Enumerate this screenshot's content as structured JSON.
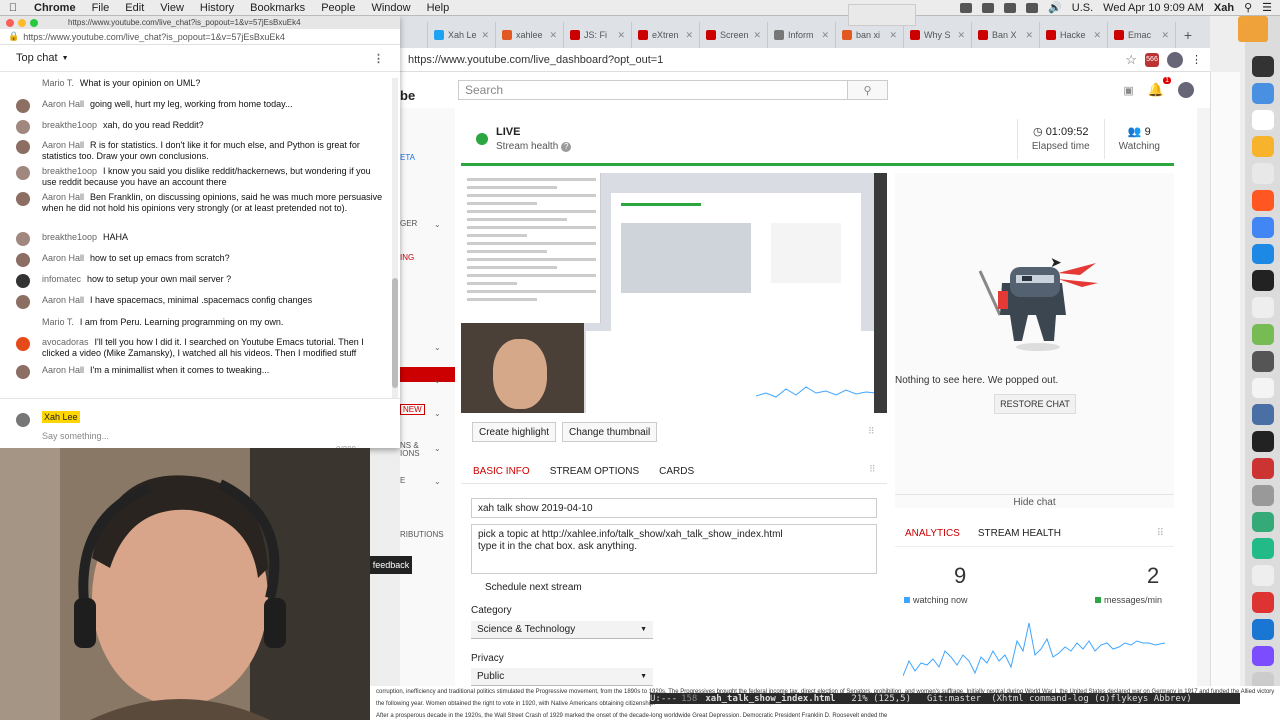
{
  "menubar": {
    "app": "Chrome",
    "items": [
      "File",
      "Edit",
      "View",
      "History",
      "Bookmarks",
      "People",
      "Window",
      "Help"
    ],
    "locale": "U.S.",
    "clock": "Wed Apr 10  9:09 AM",
    "user": "Xah"
  },
  "browser": {
    "tabs": [
      {
        "label": "Xah Le",
        "color": "#1da1f2"
      },
      {
        "label": "xahlee",
        "color": "#e25822"
      },
      {
        "label": "JS: Fi",
        "color": "#c00"
      },
      {
        "label": "eXtren",
        "color": "#c00"
      },
      {
        "label": "Screen",
        "color": "#c00"
      },
      {
        "label": "Inform",
        "color": "#777"
      },
      {
        "label": "ban xi",
        "color": "#e25822"
      },
      {
        "label": "Why S",
        "color": "#c00"
      },
      {
        "label": "Ban X",
        "color": "#c00"
      },
      {
        "label": "Hacke",
        "color": "#c00"
      },
      {
        "label": "Emac",
        "color": "#c00"
      }
    ],
    "url": "https://www.youtube.com/live_dashboard?opt_out=1",
    "ext_badge": "566"
  },
  "youtube": {
    "logo_fragment": "be",
    "search_placeholder": "Search",
    "bell_badge": "1",
    "sidebar": {
      "frag1": "ETA",
      "frag2": "GER",
      "frag3": "ING",
      "new_badge": "NEW",
      "frag4": "NS &",
      "frag5": "IONS",
      "frag6": "E",
      "frag7": "RIBUTIONS",
      "feedback": "feedback"
    },
    "status": {
      "live": "LIVE",
      "health": "Stream health",
      "elapsed_value": "01:09:52",
      "elapsed_label": "Elapsed time",
      "watching_value": "9",
      "watching_label": "Watching"
    },
    "buttons": {
      "highlight": "Create highlight",
      "thumbnail": "Change thumbnail"
    },
    "popped": {
      "message": "Nothing to see here. We popped out.",
      "restore": "RESTORE CHAT",
      "hide": "Hide chat"
    },
    "info": {
      "tabs": [
        "BASIC INFO",
        "STREAM OPTIONS",
        "CARDS"
      ],
      "title": "xah talk show 2019-04-10",
      "description_line1": "pick a topic at http://xahlee.info/talk_show/xah_talk_show_index.html",
      "description_line2": "type it in the chat box. ask anything.",
      "schedule": "Schedule next stream",
      "category_label": "Category",
      "category_value": "Science & Technology",
      "privacy_label": "Privacy",
      "privacy_value": "Public"
    },
    "analytics": {
      "tabs": [
        "ANALYTICS",
        "STREAM HEALTH"
      ],
      "watching_now": "9",
      "watching_now_label": "watching now",
      "messages": "2",
      "messages_label": "messages/min",
      "watching_color": "#3ea6ff",
      "messages_color": "#2ba640"
    }
  },
  "chat_window": {
    "title_url": "https://www.youtube.com/live_chat?is_popout=1&v=57jEsBxuEk4",
    "url": "https://www.youtube.com/live_chat?is_popout=1&v=57jEsBxuEk4",
    "header": "Top chat",
    "messages": [
      {
        "author": "Mario T.",
        "text": "What is your opinion on UML?",
        "avatar": "none"
      },
      {
        "author": "Aaron Hall",
        "text": "going well, hurt my leg, working from home today...",
        "avatar": "#8d6e63"
      },
      {
        "author": "breakthe1oop",
        "text": "xah, do you read Reddit?",
        "avatar": "#a1887f"
      },
      {
        "author": "Aaron Hall",
        "text": "R is for statistics. I don't like it for much else, and Python is great for statistics too. Draw your own conclusions.",
        "avatar": "#8d6e63"
      },
      {
        "author": "breakthe1oop",
        "text": "I know you said you dislike reddit/hackernews, but wondering if you use reddit because you have an account there",
        "avatar": "#a1887f"
      },
      {
        "author": "Aaron Hall",
        "text": "Ben Franklin, on discussing opinions, said he was much more persuasive when he did not hold his opinions very strongly (or at least pretended not to).",
        "avatar": "#8d6e63"
      },
      {
        "author": "breakthe1oop",
        "text": "HAHA",
        "avatar": "#a1887f"
      },
      {
        "author": "Aaron Hall",
        "text": "how to set up emacs from scratch?",
        "avatar": "#8d6e63"
      },
      {
        "author": "infomatec",
        "text": "how to setup your own mail server ?",
        "avatar": "#333"
      },
      {
        "author": "Aaron Hall",
        "text": "I have spacemacs, minimal .spacemacs config changes",
        "avatar": "#8d6e63"
      },
      {
        "author": "Mario T.",
        "text": "I am from Peru. Learning programming on my own.",
        "avatar": "none"
      },
      {
        "author": "avocadoras",
        "text": "I'll tell you how I did it. I searched on Youtube Emacs tutorial. Then I clicked a video (Mike Zamansky), I watched all his videos. Then I modified stuff",
        "avatar": "#e64a19"
      },
      {
        "author": "Aaron Hall",
        "text": "I'm a minimallist when it comes to tweaking...",
        "avatar": "#8d6e63"
      }
    ],
    "me": "Xah Lee",
    "placeholder": "Say something...",
    "counter": "0/200"
  },
  "editor": {
    "modeline_prefix": "U:---",
    "buffer": "xah_talk_show_index.html",
    "position": "21% (125,5)",
    "git": "Git:master",
    "modes": "(Xhtml command-log (ɑ)flykeys Abbrev)",
    "line_num": "158"
  },
  "wiki": {
    "line1": "corruption, inefficiency and traditional politics stimulated the Progressive movement, from the 1890s to 1920s. The Progressives brought the federal income tax, direct election of Senators, prohibition, and women's suffrage. Initially neutral during World War I, the United States declared war on Germany in 1917 and funded the Allied victory the following year. Women obtained the right to vote in 1920, with Native Americans obtaining citizenship.",
    "line2": "After a prosperous decade in the 1920s, the Wall Street Crash of 1929 marked the onset of the decade-long worldwide Great Depression. Democratic President Franklin D. Roosevelt ended the"
  }
}
